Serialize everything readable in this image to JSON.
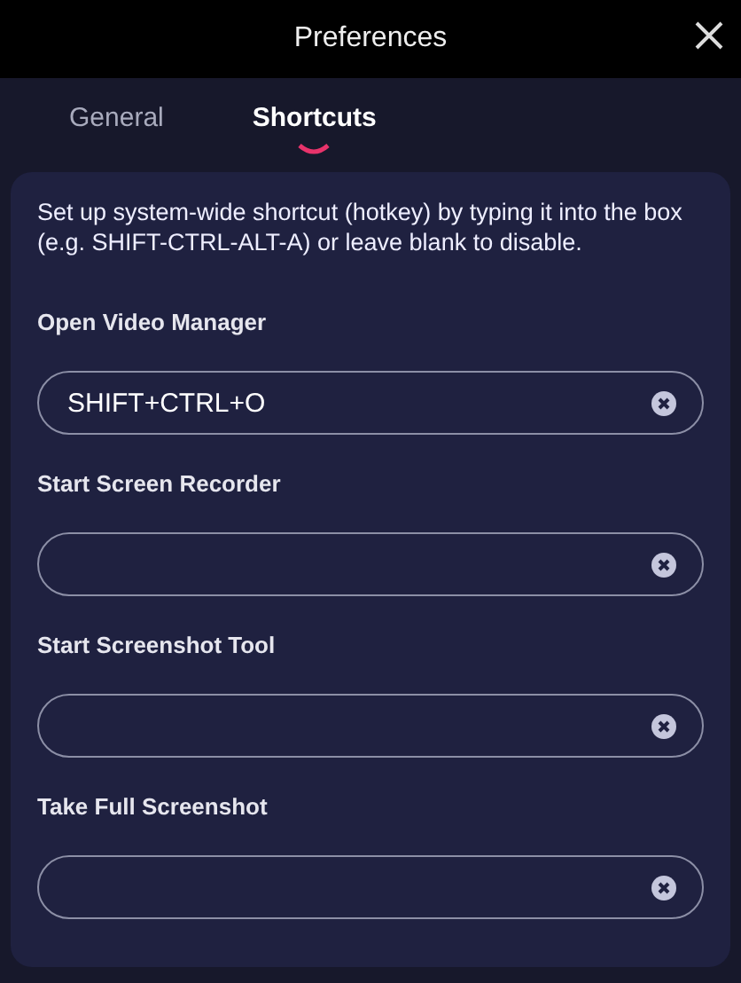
{
  "window": {
    "title": "Preferences"
  },
  "tabs": [
    {
      "label": "General",
      "selected": false
    },
    {
      "label": "Shortcuts",
      "selected": true
    }
  ],
  "description": "Set up system-wide shortcut (hotkey) by typing it into the box (e.g. SHIFT-CTRL-ALT-A) or leave blank to disable.",
  "shortcuts": [
    {
      "label": "Open Video Manager",
      "value": "SHIFT+CTRL+O"
    },
    {
      "label": "Start Screen Recorder"
    },
    {
      "label": "Start Screenshot Tool"
    },
    {
      "label": "Take Full Screenshot"
    }
  ]
}
